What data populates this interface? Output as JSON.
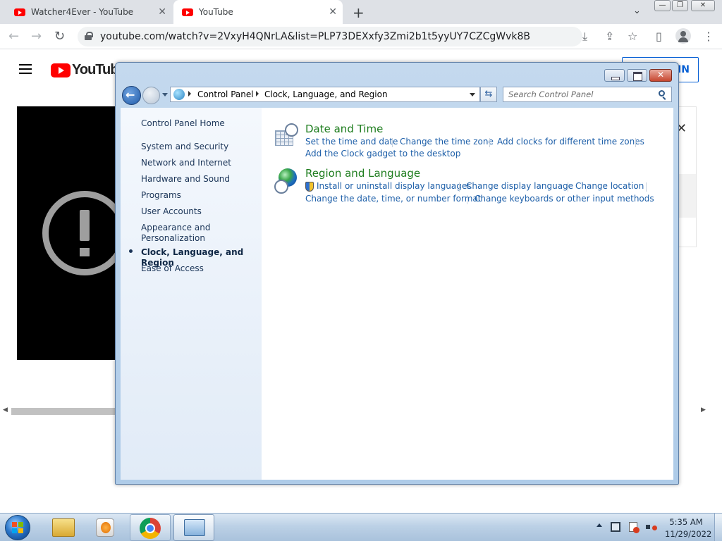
{
  "browser": {
    "tabs": [
      {
        "title": "Watcher4Ever - YouTube",
        "active": false
      },
      {
        "title": "YouTube",
        "active": true
      }
    ],
    "url": "youtube.com/watch?v=2VxyH4QNrLA&list=PLP73DEXxfy3Zmi2b1t5yyUY7CZCgWvk8B",
    "icons": {
      "back": "←",
      "forward": "→",
      "reload": "↻",
      "new_tab": "+",
      "tab_menu": "⌄",
      "close": "✕",
      "install": "⤓",
      "share": "⇪",
      "bookmark": "☆",
      "side_panel": "▯",
      "menu": "⋮",
      "win_min": "—",
      "win_restore": "❐",
      "win_close": "✕"
    }
  },
  "youtube": {
    "logo_text": "YouTube",
    "signin_label": "IN",
    "panel_close": "✕",
    "scroll_left": "◀",
    "scroll_right": "▶"
  },
  "control_panel": {
    "breadcrumb": [
      "Control Panel",
      "Clock, Language, and Region"
    ],
    "refresh_icon": "⇆",
    "search_placeholder": "Search Control Panel",
    "nav": [
      {
        "label": "Control Panel Home",
        "active": false
      },
      {
        "label": "System and Security",
        "active": false
      },
      {
        "label": "Network and Internet",
        "active": false
      },
      {
        "label": "Hardware and Sound",
        "active": false
      },
      {
        "label": "Programs",
        "active": false
      },
      {
        "label": "User Accounts",
        "active": false
      },
      {
        "label": "Appearance and Personalization",
        "active": false
      },
      {
        "label": "Clock, Language, and Region",
        "active": true
      },
      {
        "label": "Ease of Access",
        "active": false
      }
    ],
    "categories": [
      {
        "title": "Date and Time",
        "tasks": [
          "Set the time and date",
          "Change the time zone",
          "Add clocks for different time zones",
          "Add the Clock gadget to the desktop"
        ]
      },
      {
        "title": "Region and Language",
        "tasks": [
          "Install or uninstall display languages",
          "Change display language",
          "Change location",
          "Change the date, time, or number format",
          "Change keyboards or other input methods"
        ]
      }
    ]
  },
  "taskbar": {
    "time": "5:35 AM",
    "date": "11/29/2022",
    "colors": {
      "bar": "#c9daea",
      "start": "#2a76c9"
    }
  }
}
